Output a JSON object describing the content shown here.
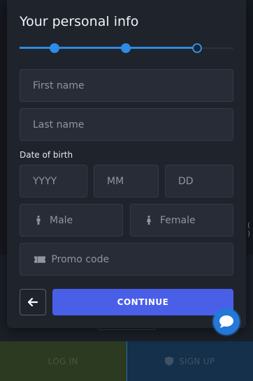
{
  "colors": {
    "accent": "#2e8be6",
    "primary_button": "#4a5fe8",
    "modal_bg": "#1f232b",
    "field_bg": "#272c36"
  },
  "modal": {
    "title": "Your personal info",
    "progress": {
      "steps": 3,
      "current_step": 3
    },
    "fields": {
      "first_name": {
        "placeholder": "First name",
        "value": ""
      },
      "last_name": {
        "placeholder": "Last name",
        "value": ""
      },
      "dob_label": "Date of birth",
      "dob_year": {
        "placeholder": "YYYY",
        "value": ""
      },
      "dob_month": {
        "placeholder": "MM",
        "value": ""
      },
      "dob_day": {
        "placeholder": "DD",
        "value": ""
      },
      "promo_code": {
        "placeholder": "Promo code",
        "value": ""
      }
    },
    "gender": {
      "male_label": "Male",
      "female_label": "Female"
    },
    "icons": {
      "male": "male-icon",
      "female": "female-icon",
      "promo": "ticket-icon",
      "back": "arrow-left-icon",
      "chat": "chat-icon"
    },
    "continue_label": "CONTINUE"
  },
  "bottom_bar": {
    "login_label": "LOG IN",
    "signup_label": "SIGN UP",
    "signup_icon": "shield-icon"
  }
}
